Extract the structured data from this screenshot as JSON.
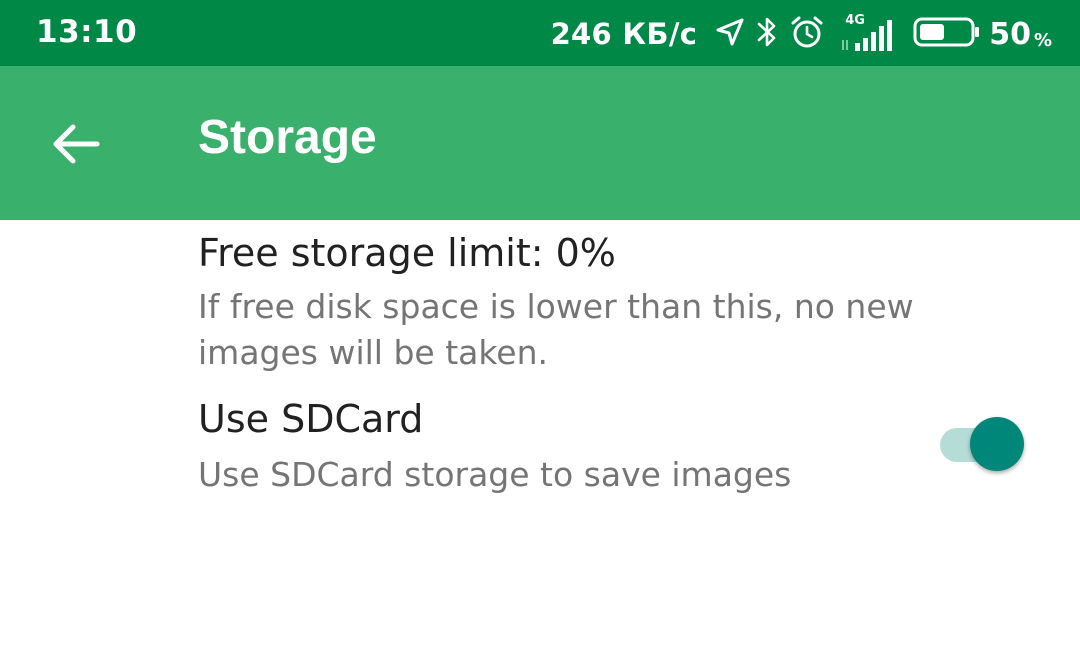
{
  "status_bar": {
    "time": "13:10",
    "net_speed": "246 КБ/с",
    "network_label": "4G",
    "battery_percent": "50",
    "battery_percent_sign": "%",
    "icons": [
      "location-arrow-icon",
      "bluetooth-icon",
      "alarm-icon",
      "signal-4g-icon",
      "battery-icon"
    ],
    "battery_level": 0.5
  },
  "app_bar": {
    "title": "Storage",
    "back_icon": "arrow-back-icon",
    "color": "#39b06b"
  },
  "preferences": [
    {
      "title": "Free storage limit: 0%",
      "summary": "If free disk space is lower than this, no new images will be taken."
    },
    {
      "title": "Use SDCard",
      "summary": "Use SDCard storage to save images",
      "switch_on": true
    }
  ],
  "colors": {
    "status_bar": "#008847",
    "app_bar": "#39b06b",
    "switch_thumb": "#00877a",
    "switch_track": "#b6dcd8"
  }
}
